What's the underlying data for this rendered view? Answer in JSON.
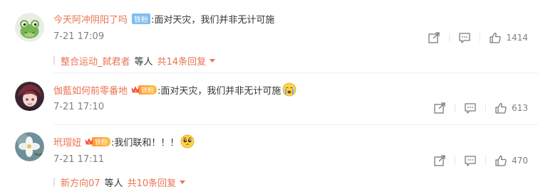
{
  "comments": [
    {
      "username": "今天阿冲阴阳了吗",
      "badge": "铁粉",
      "badge_style": "plain",
      "text": ":面对天灾，我们并非无计可施",
      "emoji": "",
      "time": "7-21 17:09",
      "likes": "1414",
      "reply_user": "整合运动_弑君者",
      "reply_etc": "等人",
      "reply_total": "共14条回复"
    },
    {
      "username": "伽藍如何前零番地",
      "badge": "铁粉",
      "badge_style": "crown",
      "text": ":面对天灾，我们并非无计可施",
      "emoji": "crying-face-emoji",
      "time": "7-21 17:10",
      "likes": "613"
    },
    {
      "username": "玳瑁妞",
      "badge": "铁粉",
      "badge_style": "crown",
      "text": ":我们联和！！！",
      "emoji": "pleading-face-emoji",
      "time": "7-21 17:11",
      "likes": "470",
      "reply_user": "新方向07",
      "reply_etc": "等人",
      "reply_total": "共10条回复"
    }
  ],
  "colors": {
    "username": "#eb7350",
    "text": "#333333",
    "meta": "#808080",
    "badge_plain": "#7fbdf0",
    "badge_crown": "#ffae3c"
  },
  "icons": {
    "forward": "forward-icon",
    "comment": "comment-icon",
    "like": "thumbs-up-icon"
  }
}
